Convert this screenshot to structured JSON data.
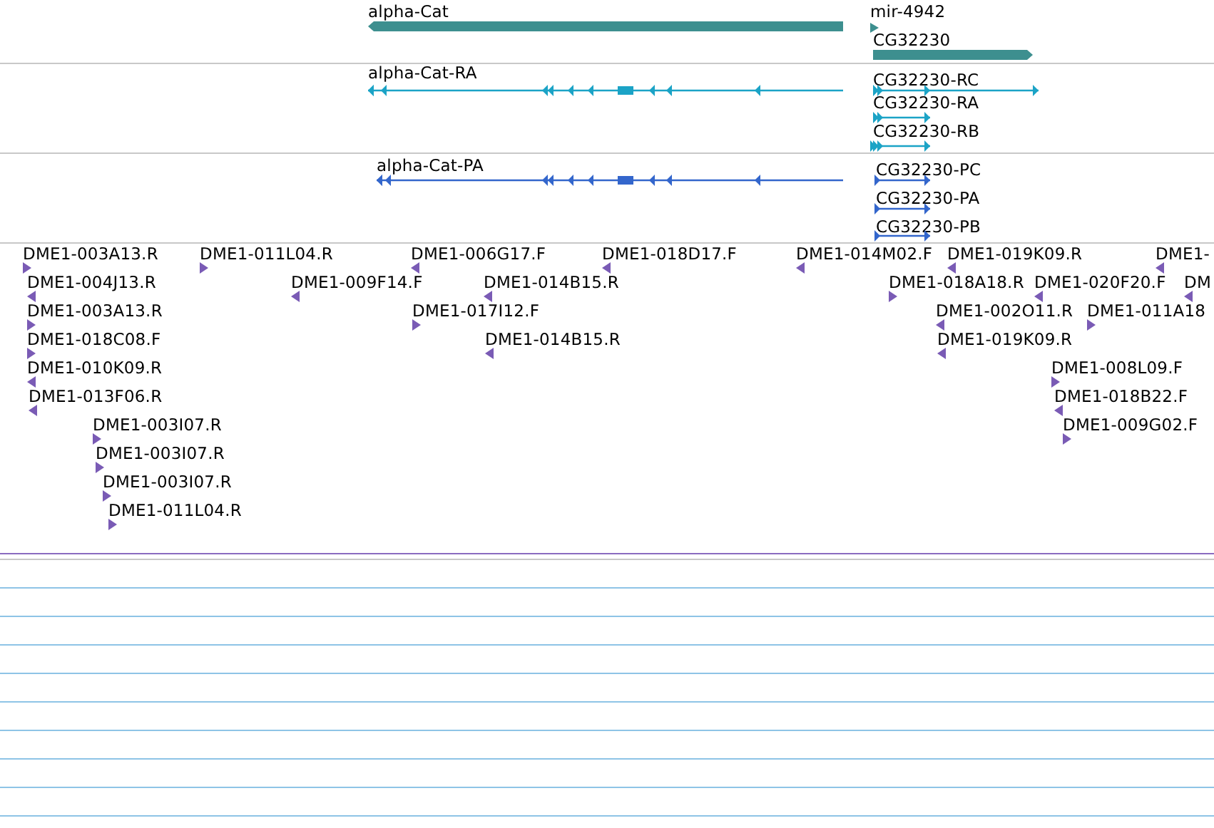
{
  "tracks": [
    {
      "kind": "gene",
      "color": "#3d8f8f",
      "features": [
        {
          "label": "alpha-Cat",
          "forward": false
        },
        {
          "label": "mir-4942",
          "forward": true
        },
        {
          "label": "CG32230",
          "forward": true
        }
      ]
    },
    {
      "kind": "transcript",
      "color": "#1ba3c6",
      "features": [
        {
          "label": "alpha-Cat-RA",
          "forward": false
        },
        {
          "label": "CG32230-RC",
          "forward": true
        },
        {
          "label": "CG32230-RA",
          "forward": true
        },
        {
          "label": "CG32230-RB",
          "forward": true
        }
      ]
    },
    {
      "kind": "transcript",
      "color": "#3366cc",
      "features": [
        {
          "label": "alpha-Cat-PA",
          "forward": false
        },
        {
          "label": "CG32230-PC",
          "forward": true
        },
        {
          "label": "CG32230-PA",
          "forward": true
        },
        {
          "label": "CG32230-PB",
          "forward": true
        }
      ]
    },
    {
      "kind": "read",
      "color": "#7a5bb5",
      "features": [
        {
          "label": "DME1-003A13.R",
          "forward": true
        },
        {
          "label": "DME1-011L04.R",
          "forward": true
        },
        {
          "label": "DME1-006G17.F",
          "forward": false
        },
        {
          "label": "DME1-018D17.F",
          "forward": false
        },
        {
          "label": "DME1-014M02.F",
          "forward": false
        },
        {
          "label": "DME1-019K09.R",
          "forward": false
        },
        {
          "label": "DME1-",
          "forward": false
        },
        {
          "label": "DME1-004J13.R",
          "forward": false
        },
        {
          "label": "DME1-009F14.F",
          "forward": false
        },
        {
          "label": "DME1-014B15.R",
          "forward": false
        },
        {
          "label": "DME1-018A18.R",
          "forward": true
        },
        {
          "label": "DME1-020F20.F",
          "forward": false
        },
        {
          "label": "DM",
          "forward": false
        },
        {
          "label": "DME1-003A13.R",
          "forward": true
        },
        {
          "label": "DME1-017I12.F",
          "forward": true
        },
        {
          "label": "DME1-002O11.R",
          "forward": false
        },
        {
          "label": "DME1-011A18",
          "forward": true
        },
        {
          "label": "DME1-018C08.F",
          "forward": true
        },
        {
          "label": "DME1-014B15.R",
          "forward": false
        },
        {
          "label": "DME1-019K09.R",
          "forward": false
        },
        {
          "label": "DME1-010K09.R",
          "forward": false
        },
        {
          "label": "DME1-008L09.F",
          "forward": true
        },
        {
          "label": "DME1-013F06.R",
          "forward": false
        },
        {
          "label": "DME1-018B22.F",
          "forward": false
        },
        {
          "label": "DME1-003I07.R",
          "forward": true
        },
        {
          "label": "DME1-009G02.F",
          "forward": true
        },
        {
          "label": "DME1-003I07.R",
          "forward": true
        },
        {
          "label": "DME1-003I07.R",
          "forward": true
        },
        {
          "label": "DME1-011L04.R",
          "forward": true
        }
      ]
    }
  ]
}
